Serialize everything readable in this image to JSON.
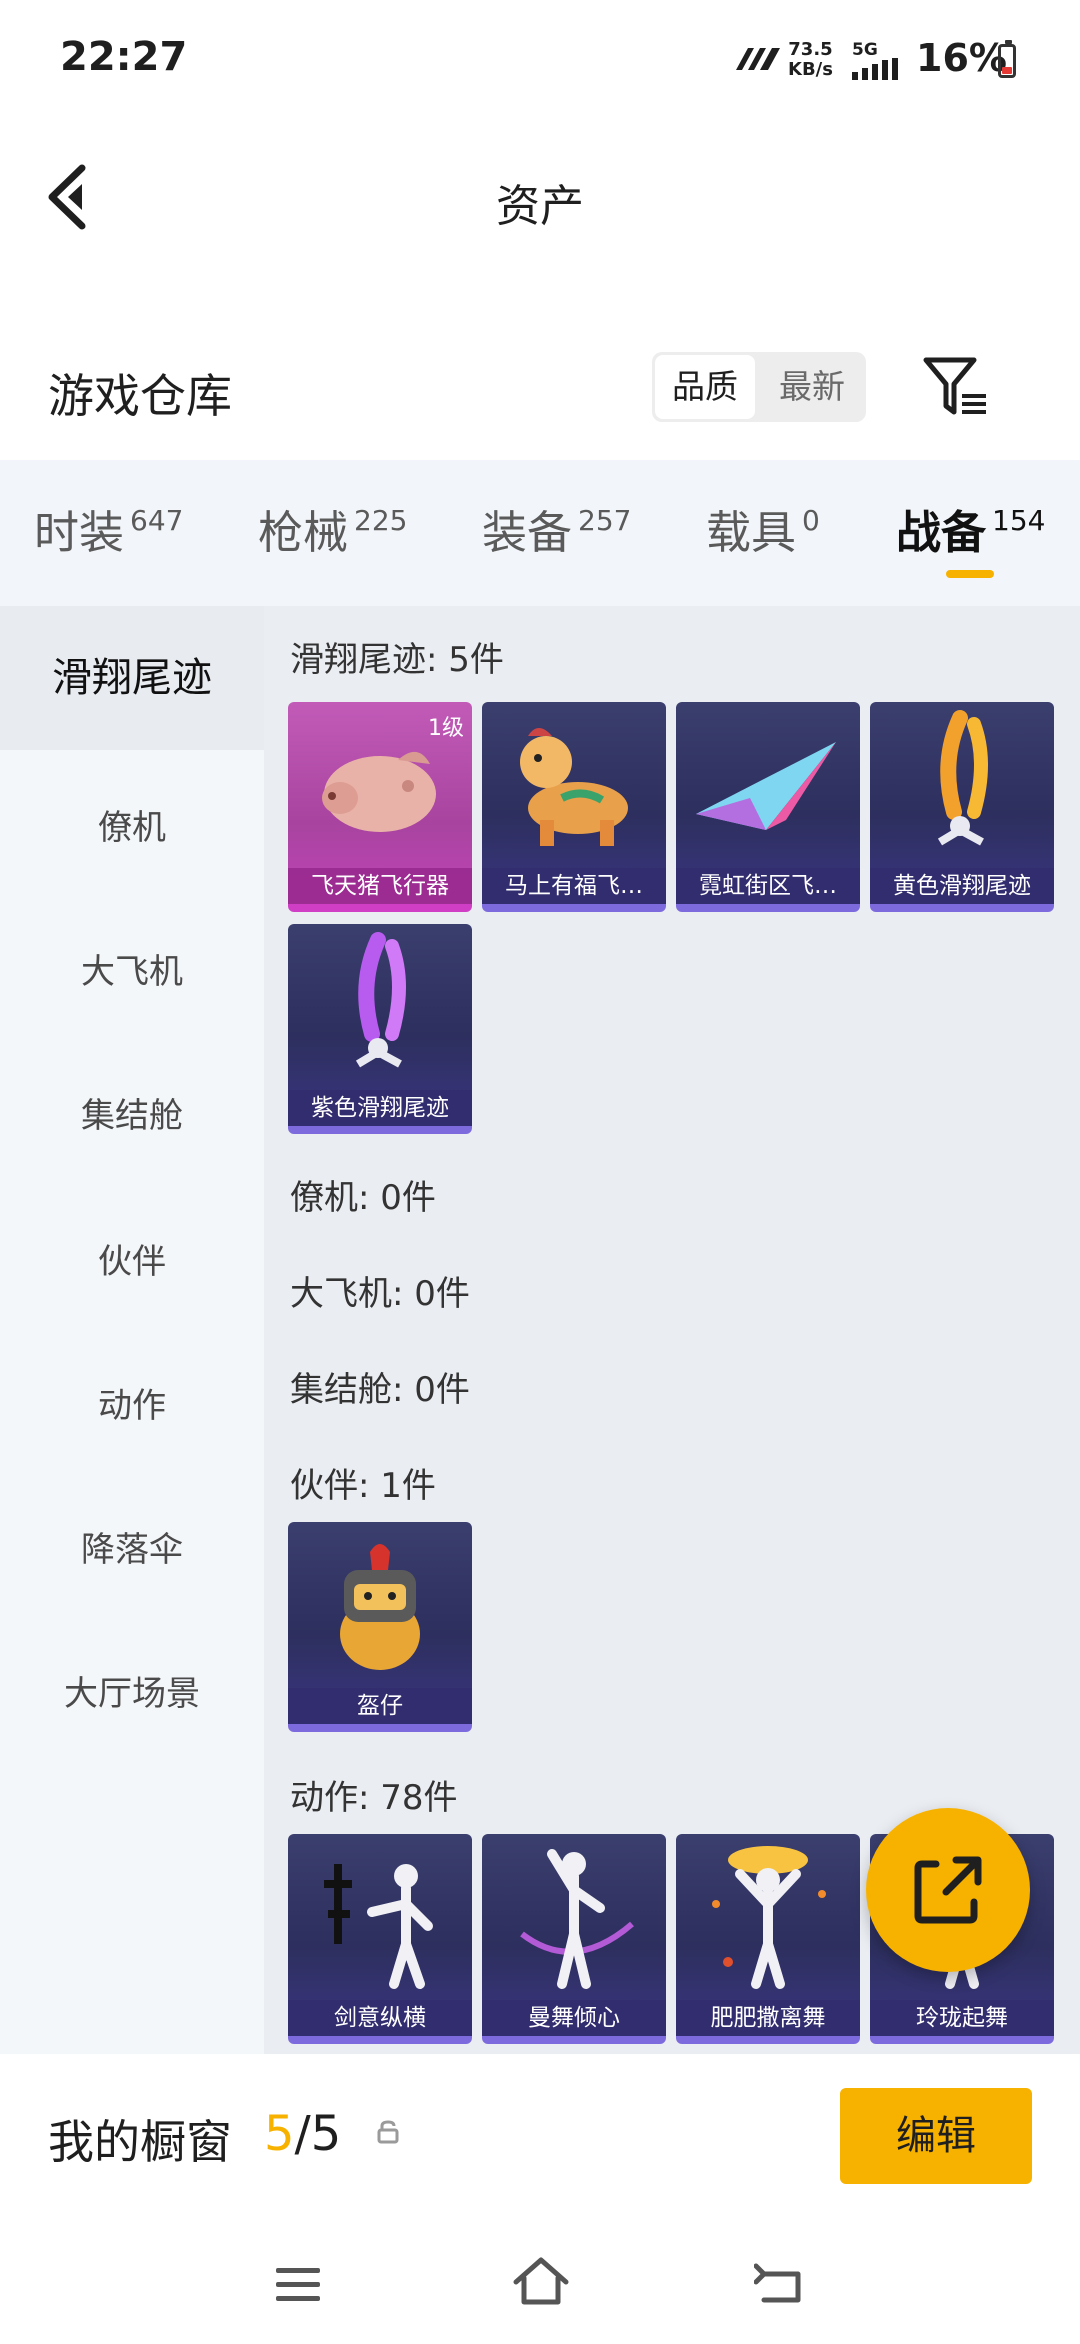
{
  "status_bar": {
    "time": "22:27",
    "net_speed_value": "73.5",
    "net_speed_unit": "KB/s",
    "network": "5G",
    "battery": "16%"
  },
  "header": {
    "title": "资产"
  },
  "warehouse": {
    "title": "游戏仓库",
    "sort_options": [
      "品质",
      "最新"
    ],
    "selected_sort": "品质"
  },
  "tabs": [
    {
      "label": "时装",
      "count": "647"
    },
    {
      "label": "枪械",
      "count": "225"
    },
    {
      "label": "装备",
      "count": "257"
    },
    {
      "label": "载具",
      "count": "0"
    },
    {
      "label": "战备",
      "count": "154"
    }
  ],
  "active_tab": "战备",
  "sidebar": {
    "items": [
      "滑翔尾迹",
      "僚机",
      "大飞机",
      "集结舱",
      "伙伴",
      "动作",
      "降落伞",
      "大厅场景"
    ],
    "selected": "滑翔尾迹"
  },
  "sections": {
    "glide_trail": {
      "title": "滑翔尾迹: 5件",
      "items": [
        {
          "name": "飞天猪飞行器",
          "level": "1级"
        },
        {
          "name": "马上有福飞…"
        },
        {
          "name": "霓虹街区飞…"
        },
        {
          "name": "黄色滑翔尾迹"
        },
        {
          "name": "紫色滑翔尾迹"
        }
      ]
    },
    "wingman": {
      "title": "僚机: 0件"
    },
    "big_plane": {
      "title": "大飞机: 0件"
    },
    "pod": {
      "title": "集结舱: 0件"
    },
    "companion": {
      "title": "伙伴: 1件",
      "items": [
        {
          "name": "盔仔"
        }
      ]
    },
    "emote": {
      "title": "动作: 78件",
      "items": [
        {
          "name": "剑意纵横"
        },
        {
          "name": "曼舞倾心"
        },
        {
          "name": "肥肥撒离舞"
        },
        {
          "name": "玲珑起舞"
        }
      ]
    }
  },
  "showcase": {
    "label": "我的橱窗",
    "current": "5",
    "separator": "/",
    "total": "5",
    "edit_label": "编辑"
  },
  "colors": {
    "accent": "#f7b200",
    "card_bg": "#2d2f5e",
    "card_border": "#7d6bde",
    "card_pink": "#c043b8"
  }
}
